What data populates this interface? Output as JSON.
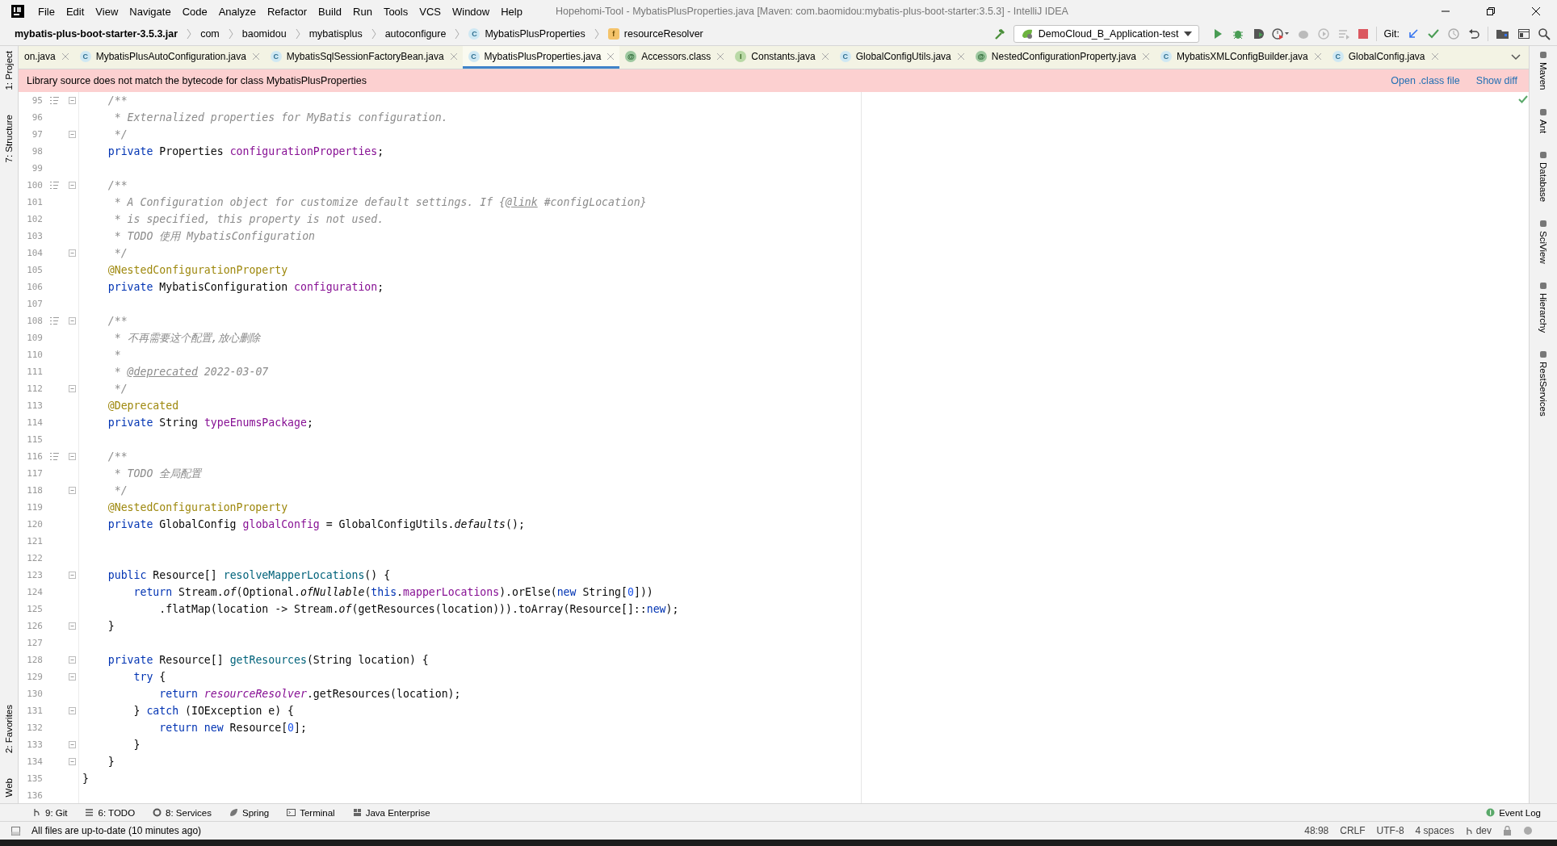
{
  "window": {
    "title": "Hopehomi-Tool - MybatisPlusProperties.java [Maven: com.baomidou:mybatis-plus-boot-starter:3.5.3] - IntelliJ IDEA"
  },
  "menu": [
    "File",
    "Edit",
    "View",
    "Navigate",
    "Code",
    "Analyze",
    "Refactor",
    "Build",
    "Run",
    "Tools",
    "VCS",
    "Window",
    "Help"
  ],
  "breadcrumbs": [
    {
      "label": "mybatis-plus-boot-starter-3.5.3.jar",
      "kind": "root"
    },
    {
      "label": "com",
      "kind": "package"
    },
    {
      "label": "baomidou",
      "kind": "package"
    },
    {
      "label": "mybatisplus",
      "kind": "package"
    },
    {
      "label": "autoconfigure",
      "kind": "package"
    },
    {
      "label": "MybatisPlusProperties",
      "kind": "class",
      "icon": "C"
    },
    {
      "label": "resourceResolver",
      "kind": "field",
      "icon": "f"
    }
  ],
  "run_configuration": "DemoCloud_B_Application-test",
  "git_label": "Git:",
  "tabs": [
    {
      "label": "on.java",
      "selected": false
    },
    {
      "label": "MybatisPlusAutoConfiguration.java",
      "kind": "class",
      "icon": "C",
      "selected": false
    },
    {
      "label": "MybatisSqlSessionFactoryBean.java",
      "kind": "class",
      "icon": "C",
      "selected": false
    },
    {
      "label": "MybatisPlusProperties.java",
      "kind": "class",
      "icon": "C",
      "selected": true
    },
    {
      "label": "Accessors.class",
      "kind": "annotation",
      "icon": "@",
      "selected": false
    },
    {
      "label": "Constants.java",
      "kind": "interface",
      "icon": "I",
      "selected": false
    },
    {
      "label": "GlobalConfigUtils.java",
      "kind": "class",
      "icon": "C",
      "selected": false
    },
    {
      "label": "NestedConfigurationProperty.java",
      "kind": "annotation",
      "icon": "@",
      "selected": false
    },
    {
      "label": "MybatisXMLConfigBuilder.java",
      "kind": "class",
      "icon": "C",
      "selected": false
    },
    {
      "label": "GlobalConfig.java",
      "kind": "class",
      "icon": "C",
      "selected": false
    }
  ],
  "banner": {
    "message": "Library source does not match the bytecode for class MybatisPlusProperties",
    "links": [
      "Open .class file",
      "Show diff"
    ]
  },
  "left_tool_windows": {
    "top": [
      "1: Project",
      "7: Structure"
    ],
    "bottom": [
      "2: Favorites",
      "Web"
    ]
  },
  "right_tool_windows": [
    "Maven",
    "Ant",
    "Database",
    "SciView",
    "Hierarchy",
    "RestServices"
  ],
  "editor": {
    "lines": [
      {
        "number": "95",
        "fold": true,
        "doc": true,
        "tokens": [
          {
            "kind": "comment",
            "text": "    /**"
          }
        ]
      },
      {
        "number": "96",
        "fold": false,
        "doc": false,
        "tokens": [
          {
            "kind": "comment",
            "text": "     * Externalized properties for MyBatis configuration."
          }
        ]
      },
      {
        "number": "97",
        "fold": true,
        "doc": false,
        "tokens": [
          {
            "kind": "comment",
            "text": "     */"
          }
        ]
      },
      {
        "number": "98",
        "fold": false,
        "doc": false,
        "tokens": [
          {
            "kind": "keyword",
            "text": "    private"
          },
          {
            "kind": "plain",
            "text": " Properties "
          },
          {
            "kind": "field",
            "text": "configurationProperties"
          },
          {
            "kind": "plain",
            "text": ";"
          }
        ]
      },
      {
        "number": "99",
        "fold": false,
        "doc": false
      },
      {
        "number": "100",
        "fold": true,
        "doc": true,
        "tokens": [
          {
            "kind": "comment",
            "text": "    /**"
          }
        ]
      },
      {
        "number": "101",
        "fold": false,
        "doc": false,
        "tokens": [
          {
            "kind": "comment",
            "text": "     * A Configuration object for customize default settings. If {"
          },
          {
            "kind": "doctag",
            "text": "@link"
          },
          {
            "kind": "comment",
            "text": " #configLocation}"
          }
        ]
      },
      {
        "number": "102",
        "fold": false,
        "doc": false,
        "tokens": [
          {
            "kind": "comment",
            "text": "     * is specified, this property is not used."
          }
        ]
      },
      {
        "number": "103",
        "fold": false,
        "doc": false,
        "tokens": [
          {
            "kind": "comment",
            "text": "     * TODO 使用 MybatisConfiguration"
          }
        ]
      },
      {
        "number": "104",
        "fold": true,
        "doc": false,
        "tokens": [
          {
            "kind": "comment",
            "text": "     */"
          }
        ]
      },
      {
        "number": "105",
        "fold": false,
        "doc": false,
        "tokens": [
          {
            "kind": "annotation",
            "text": "    @NestedConfigurationProperty"
          }
        ]
      },
      {
        "number": "106",
        "fold": false,
        "doc": false,
        "tokens": [
          {
            "kind": "keyword",
            "text": "    private"
          },
          {
            "kind": "plain",
            "text": " MybatisConfiguration "
          },
          {
            "kind": "field",
            "text": "configuration"
          },
          {
            "kind": "plain",
            "text": ";"
          }
        ]
      },
      {
        "number": "107",
        "fold": false,
        "doc": false
      },
      {
        "number": "108",
        "fold": true,
        "doc": true,
        "tokens": [
          {
            "kind": "comment",
            "text": "    /**"
          }
        ]
      },
      {
        "number": "109",
        "fold": false,
        "doc": false,
        "tokens": [
          {
            "kind": "comment",
            "text": "     * 不再需要这个配置,放心删除"
          }
        ]
      },
      {
        "number": "110",
        "fold": false,
        "doc": false,
        "tokens": [
          {
            "kind": "comment",
            "text": "     *"
          }
        ]
      },
      {
        "number": "111",
        "fold": false,
        "doc": false,
        "tokens": [
          {
            "kind": "comment",
            "text": "     * "
          },
          {
            "kind": "doctag",
            "text": "@deprecated"
          },
          {
            "kind": "comment",
            "text": " 2022-03-07"
          }
        ]
      },
      {
        "number": "112",
        "fold": true,
        "doc": false,
        "tokens": [
          {
            "kind": "comment",
            "text": "     */"
          }
        ]
      },
      {
        "number": "113",
        "fold": false,
        "doc": false,
        "tokens": [
          {
            "kind": "annotation",
            "text": "    @Deprecated"
          }
        ]
      },
      {
        "number": "114",
        "fold": false,
        "doc": false,
        "tokens": [
          {
            "kind": "keyword",
            "text": "    private"
          },
          {
            "kind": "plain",
            "text": " String "
          },
          {
            "kind": "field",
            "text": "typeEnumsPackage"
          },
          {
            "kind": "plain",
            "text": ";"
          }
        ]
      },
      {
        "number": "115",
        "fold": false,
        "doc": false
      },
      {
        "number": "116",
        "fold": true,
        "doc": true,
        "tokens": [
          {
            "kind": "comment",
            "text": "    /**"
          }
        ]
      },
      {
        "number": "117",
        "fold": false,
        "doc": false,
        "tokens": [
          {
            "kind": "comment",
            "text": "     * TODO 全局配置"
          }
        ]
      },
      {
        "number": "118",
        "fold": true,
        "doc": false,
        "tokens": [
          {
            "kind": "comment",
            "text": "     */"
          }
        ]
      },
      {
        "number": "119",
        "fold": false,
        "doc": false,
        "tokens": [
          {
            "kind": "annotation",
            "text": "    @NestedConfigurationProperty"
          }
        ]
      },
      {
        "number": "120",
        "fold": false,
        "doc": false,
        "tokens": [
          {
            "kind": "keyword",
            "text": "    private"
          },
          {
            "kind": "plain",
            "text": " GlobalConfig "
          },
          {
            "kind": "field",
            "text": "globalConfig"
          },
          {
            "kind": "plain",
            "text": " = GlobalConfigUtils."
          },
          {
            "kind": "static",
            "text": "defaults"
          },
          {
            "kind": "plain",
            "text": "();"
          }
        ]
      },
      {
        "number": "121",
        "fold": false,
        "doc": false
      },
      {
        "number": "122",
        "fold": false,
        "doc": false
      },
      {
        "number": "123",
        "fold": true,
        "doc": false,
        "tokens": [
          {
            "kind": "keyword",
            "text": "    public"
          },
          {
            "kind": "plain",
            "text": " Resource[] "
          },
          {
            "kind": "method",
            "text": "resolveMapperLocations"
          },
          {
            "kind": "plain",
            "text": "() {"
          }
        ]
      },
      {
        "number": "124",
        "fold": false,
        "doc": false,
        "tokens": [
          {
            "kind": "keyword",
            "text": "        return"
          },
          {
            "kind": "plain",
            "text": " Stream."
          },
          {
            "kind": "static",
            "text": "of"
          },
          {
            "kind": "plain",
            "text": "(Optional."
          },
          {
            "kind": "static",
            "text": "ofNullable"
          },
          {
            "kind": "plain",
            "text": "("
          },
          {
            "kind": "keyword",
            "text": "this"
          },
          {
            "kind": "plain",
            "text": "."
          },
          {
            "kind": "field",
            "text": "mapperLocations"
          },
          {
            "kind": "plain",
            "text": ").orElse("
          },
          {
            "kind": "keyword",
            "text": "new"
          },
          {
            "kind": "plain",
            "text": " String["
          },
          {
            "kind": "number",
            "text": "0"
          },
          {
            "kind": "plain",
            "text": "]))"
          }
        ]
      },
      {
        "number": "125",
        "fold": false,
        "doc": false,
        "tokens": [
          {
            "kind": "plain",
            "text": "            .flatMap(location -> Stream."
          },
          {
            "kind": "static",
            "text": "of"
          },
          {
            "kind": "plain",
            "text": "(getResources(location))).toArray(Resource[]::"
          },
          {
            "kind": "keyword",
            "text": "new"
          },
          {
            "kind": "plain",
            "text": ");"
          }
        ]
      },
      {
        "number": "126",
        "fold": true,
        "doc": false,
        "tokens": [
          {
            "kind": "plain",
            "text": "    }"
          }
        ]
      },
      {
        "number": "127",
        "fold": false,
        "doc": false
      },
      {
        "number": "128",
        "fold": true,
        "doc": false,
        "tokens": [
          {
            "kind": "keyword",
            "text": "    private"
          },
          {
            "kind": "plain",
            "text": " Resource[] "
          },
          {
            "kind": "method",
            "text": "getResources"
          },
          {
            "kind": "plain",
            "text": "(String location) {"
          }
        ]
      },
      {
        "number": "129",
        "fold": true,
        "doc": false,
        "tokens": [
          {
            "kind": "keyword",
            "text": "        try"
          },
          {
            "kind": "plain",
            "text": " {"
          }
        ]
      },
      {
        "number": "130",
        "fold": false,
        "doc": false,
        "tokens": [
          {
            "kind": "keyword",
            "text": "            return "
          },
          {
            "kind": "static-field",
            "text": "resourceResolver"
          },
          {
            "kind": "plain",
            "text": ".getResources(location);"
          }
        ]
      },
      {
        "number": "131",
        "fold": true,
        "doc": false,
        "tokens": [
          {
            "kind": "plain",
            "text": "        } "
          },
          {
            "kind": "keyword",
            "text": "catch"
          },
          {
            "kind": "plain",
            "text": " (IOException e) {"
          }
        ]
      },
      {
        "number": "132",
        "fold": false,
        "doc": false,
        "tokens": [
          {
            "kind": "keyword",
            "text": "            return new"
          },
          {
            "kind": "plain",
            "text": " Resource["
          },
          {
            "kind": "number",
            "text": "0"
          },
          {
            "kind": "plain",
            "text": "];"
          }
        ]
      },
      {
        "number": "133",
        "fold": true,
        "doc": false,
        "tokens": [
          {
            "kind": "plain",
            "text": "        }"
          }
        ]
      },
      {
        "number": "134",
        "fold": true,
        "doc": false,
        "tokens": [
          {
            "kind": "plain",
            "text": "    }"
          }
        ]
      },
      {
        "number": "135",
        "fold": false,
        "doc": false,
        "tokens": [
          {
            "kind": "plain",
            "text": "}"
          }
        ]
      },
      {
        "number": "136",
        "fold": false,
        "doc": false
      }
    ]
  },
  "tool_buttons": [
    {
      "label": "9: Git",
      "kind": "git"
    },
    {
      "label": "6: TODO",
      "kind": "todo"
    },
    {
      "label": "8: Services",
      "kind": "services"
    },
    {
      "label": "Spring",
      "kind": "spring"
    },
    {
      "label": "Terminal",
      "kind": "terminal"
    },
    {
      "label": "Java Enterprise",
      "kind": "enterprise"
    }
  ],
  "event_log": "Event Log",
  "status_bar": {
    "message": "All files are up-to-date (10 minutes ago)",
    "position": "48:98",
    "line_separator": "CRLF",
    "encoding": "UTF-8",
    "indent": "4 spaces",
    "branch": "dev"
  }
}
